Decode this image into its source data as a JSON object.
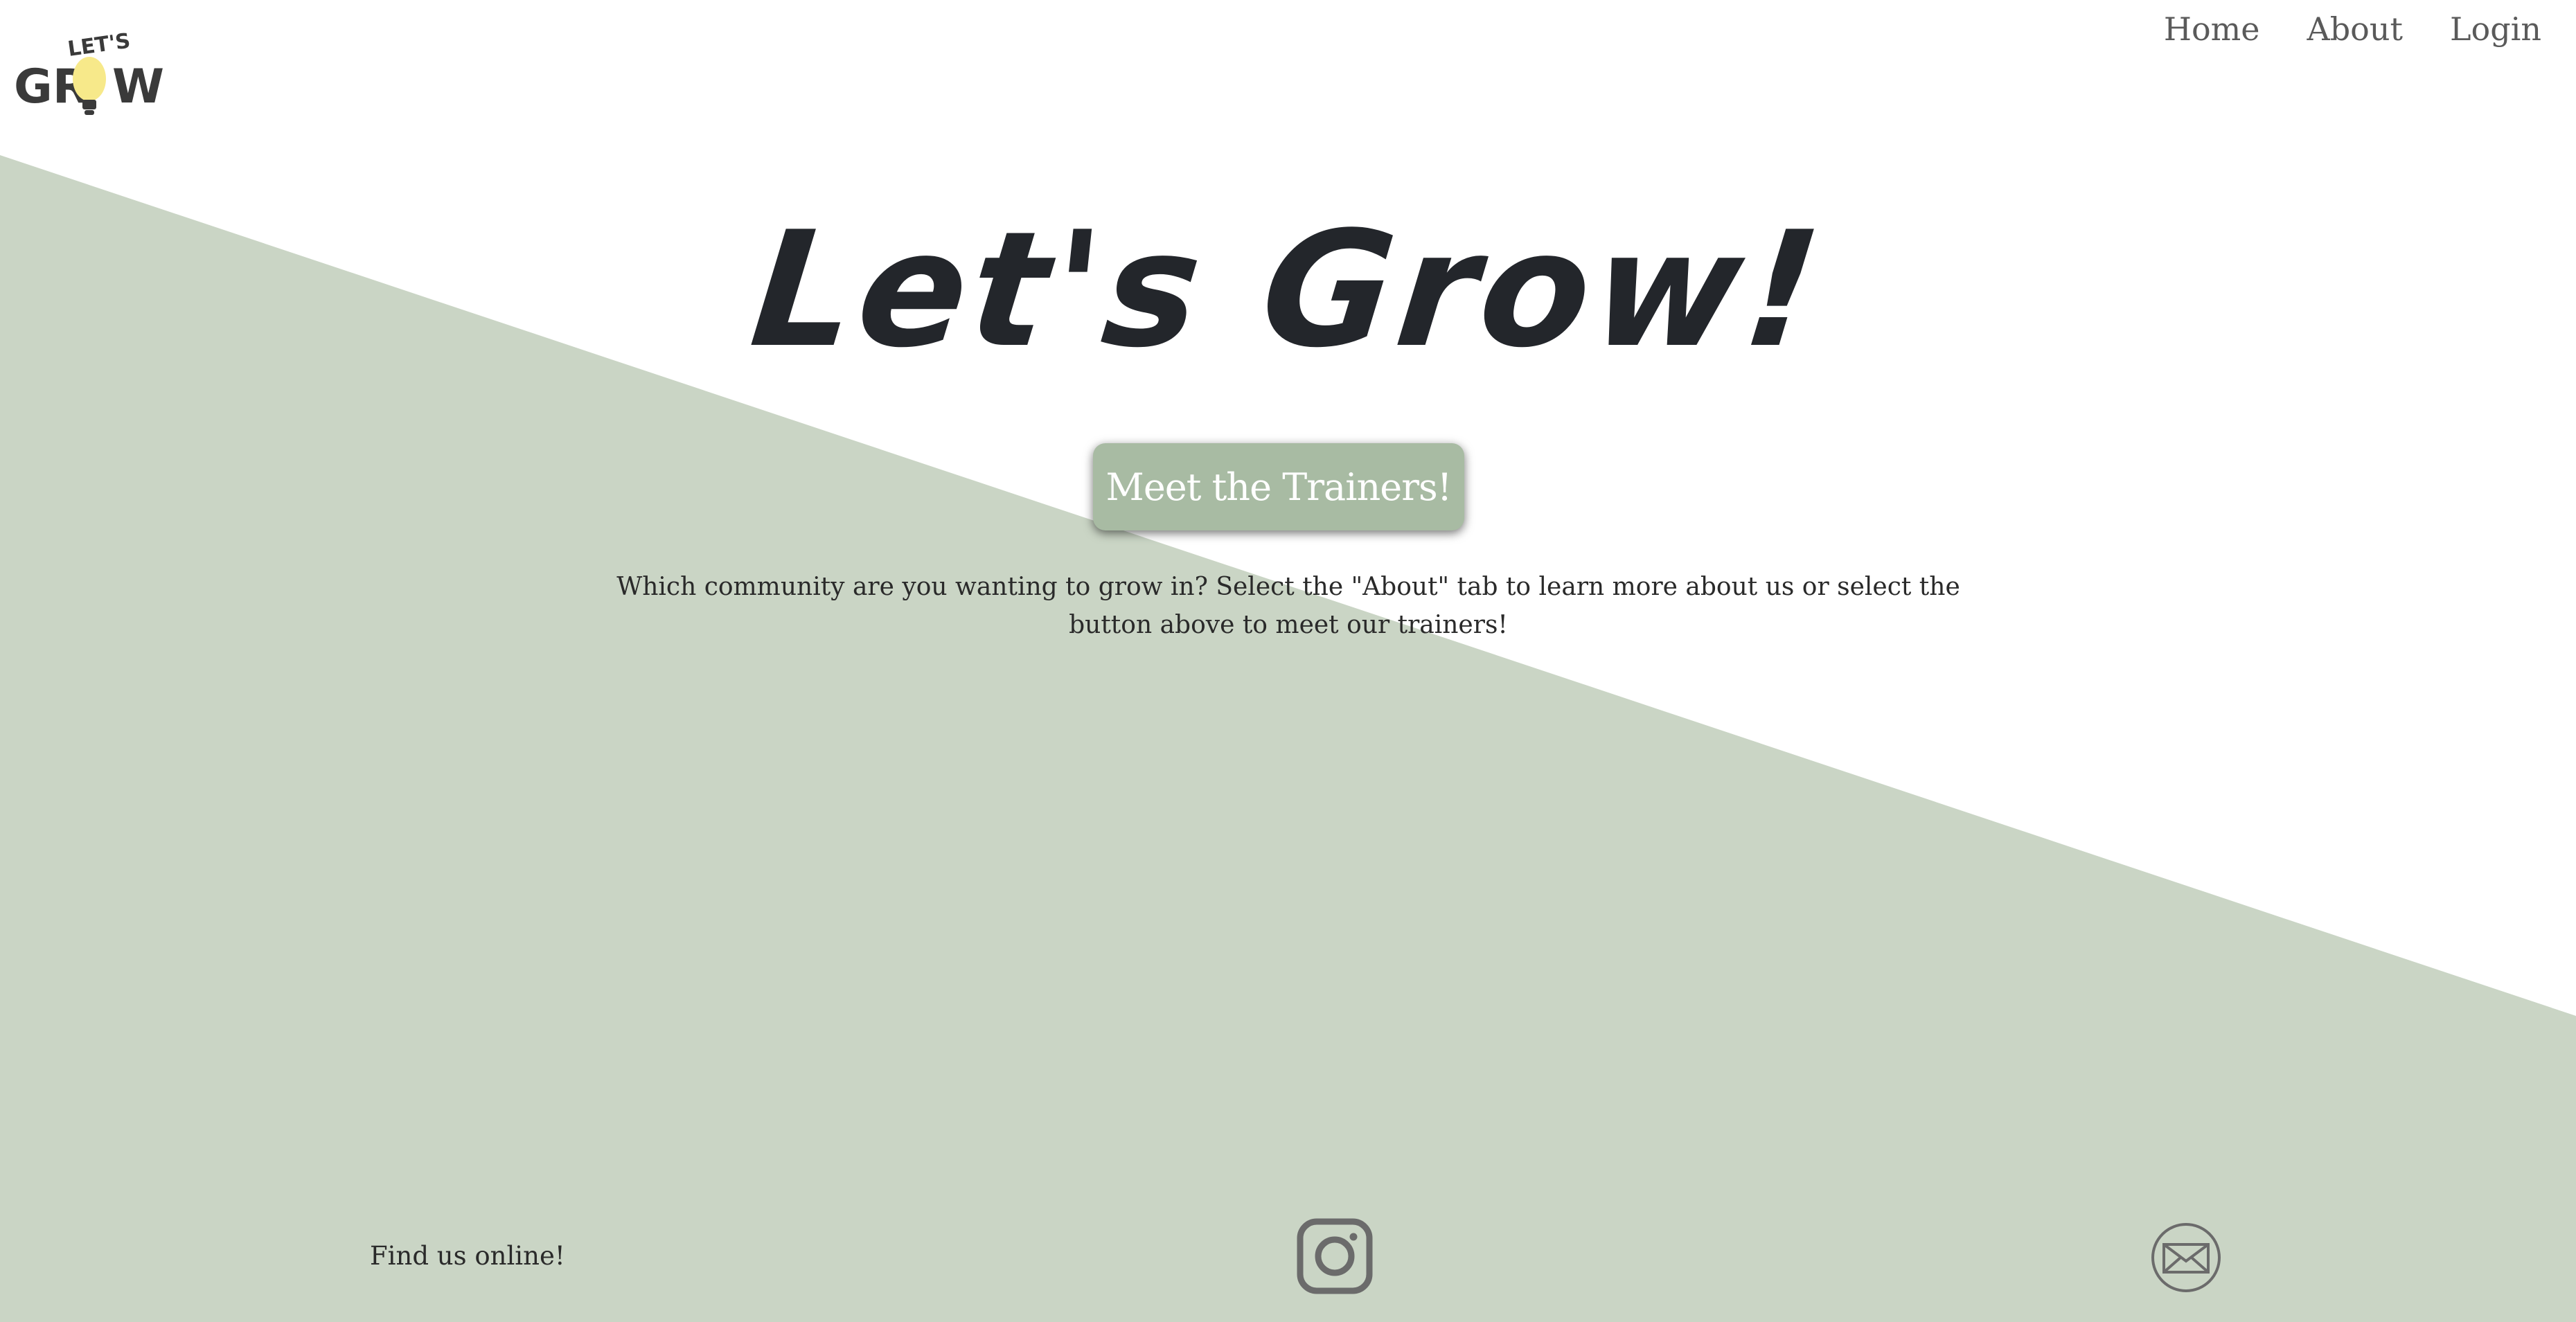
{
  "logo": {
    "top_text": "LET'S",
    "main_text_left": "GR",
    "main_text_right": "W",
    "icon": "lightbulb-icon",
    "bulb_color": "#f7e98a"
  },
  "nav": {
    "items": [
      {
        "label": "Home"
      },
      {
        "label": "About"
      },
      {
        "label": "Login"
      }
    ]
  },
  "hero": {
    "title": "Let's Grow!",
    "button_label": "Meet the Trainers!",
    "description": "Which community are you wanting to grow in? Select the \"About\" tab to learn more about us or select the button above to meet our trainers!"
  },
  "footer": {
    "find_text": "Find us online!",
    "icons": [
      "instagram-icon",
      "mail-icon"
    ]
  },
  "colors": {
    "background_shape": "#cad5c5",
    "button": "#a8bba3",
    "text_dark": "#23262b",
    "nav_text": "#5a5a5a",
    "icon_gray": "#6b6b6b"
  }
}
